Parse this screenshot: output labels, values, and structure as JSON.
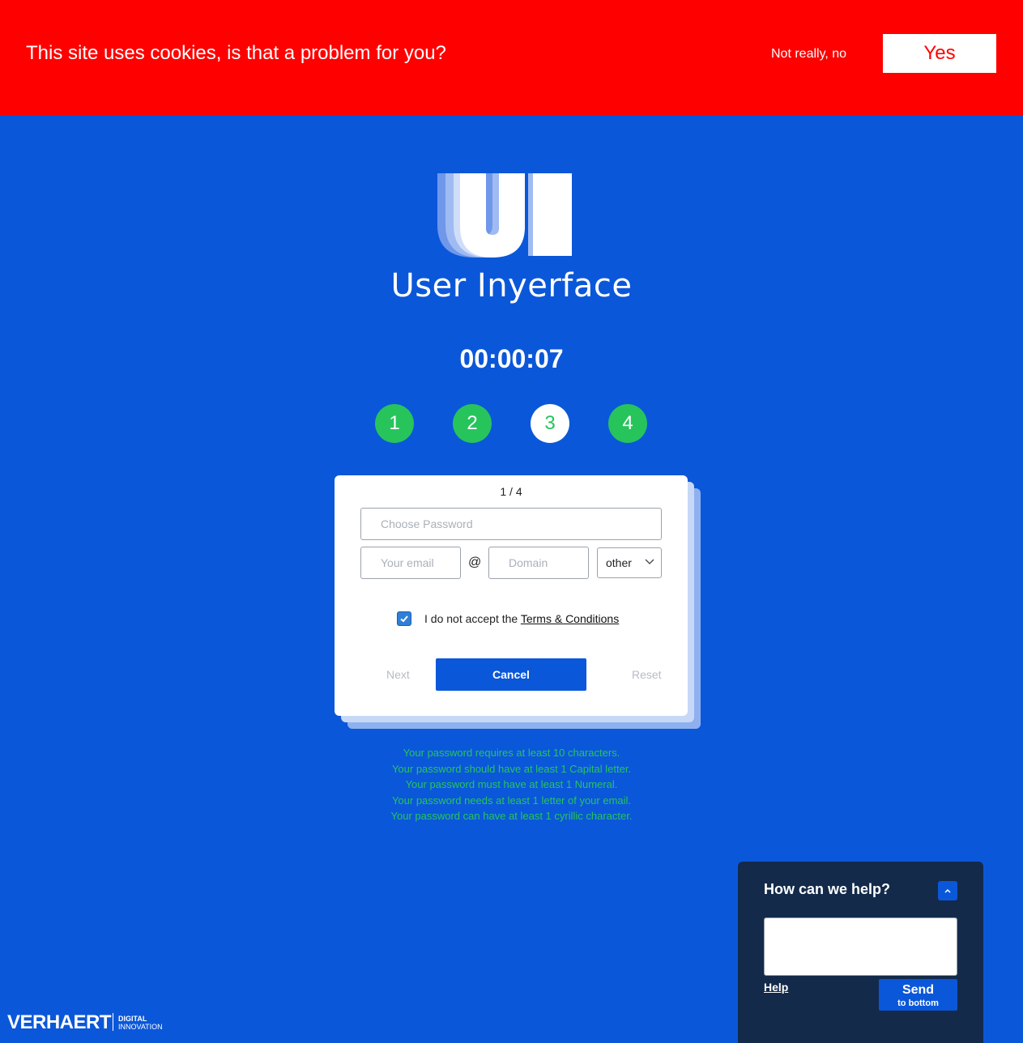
{
  "cookie_banner": {
    "message": "This site uses cookies, is that a problem for you?",
    "decline_label": "Not really, no",
    "accept_label": "Yes"
  },
  "header": {
    "logo_letters": "UI",
    "app_title": "User Inyerface",
    "timer": "00:00:07"
  },
  "steps": [
    {
      "label": "1",
      "active": false
    },
    {
      "label": "2",
      "active": false
    },
    {
      "label": "3",
      "active": true
    },
    {
      "label": "4",
      "active": false
    }
  ],
  "form": {
    "pager": "1 / 4",
    "password_placeholder": "Choose Password",
    "email_placeholder": "Your email",
    "at_sign": "@",
    "domain_placeholder": "Domain",
    "tld_value": "other",
    "terms_prefix": "I do not accept the ",
    "terms_link": "Terms & Conditions",
    "terms_checked": true,
    "next_label": "Next",
    "cancel_label": "Cancel",
    "reset_label": "Reset"
  },
  "password_rules": [
    "Your password requires at least 10 characters.",
    "Your password should have at least 1 Capital letter.",
    "Your password must have at least 1 Numeral.",
    "Your password needs at least 1 letter of your email.",
    "Your password can have at least 1 cyrillic character."
  ],
  "help_widget": {
    "title": "How can we help?",
    "help_link": "Help",
    "send_label": "Send",
    "send_sub_label": "to bottom"
  },
  "footer": {
    "brand_name": "VERHAERT",
    "brand_line1": "DIGITAL",
    "brand_line2": "INNOVATION"
  },
  "colors": {
    "background": "#0b57d9",
    "cookie_bar": "#ff0000",
    "step_green": "#27c45c",
    "help_panel": "#132a4a"
  },
  "icons": {
    "checkbox": "check-icon",
    "select": "chevron-down-icon",
    "help_toggle": "chevron-up-icon"
  }
}
